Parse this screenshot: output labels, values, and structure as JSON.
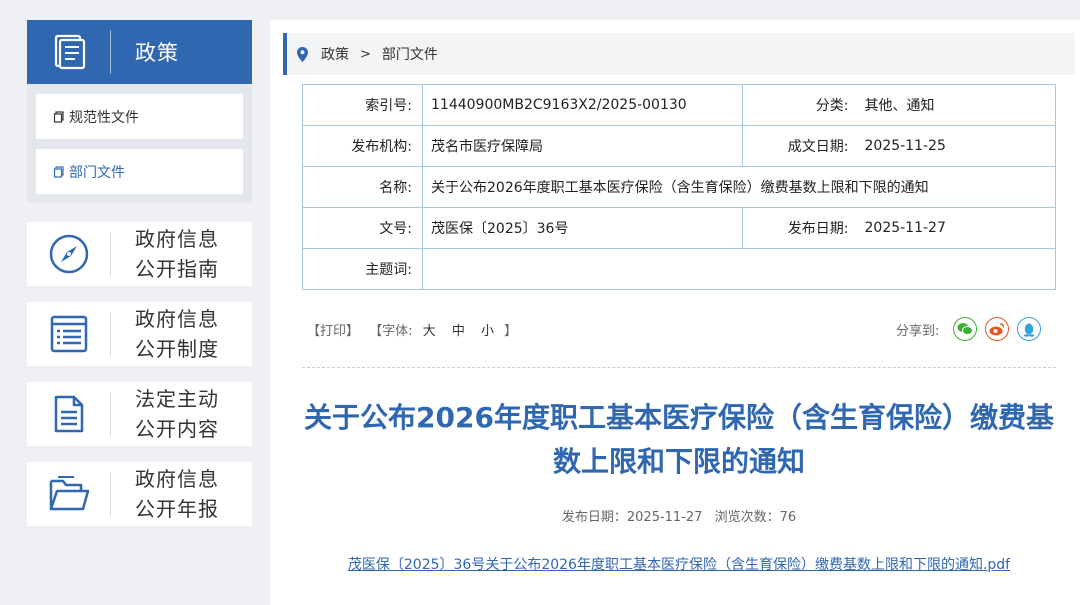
{
  "sidebar": {
    "header_title": "政策",
    "sub_items": [
      {
        "label": "规范性文件"
      },
      {
        "label": "部门文件"
      }
    ],
    "cards": [
      {
        "line1": "政府信息",
        "line2": "公开指南",
        "icon": "compass-icon"
      },
      {
        "line1": "政府信息",
        "line2": "公开制度",
        "icon": "list-document-icon"
      },
      {
        "line1": "法定主动",
        "line2": "公开内容",
        "icon": "document-icon"
      },
      {
        "line1": "政府信息",
        "line2": "公开年报",
        "icon": "folder-icon"
      }
    ]
  },
  "breadcrumb": {
    "items": [
      "政策",
      "部门文件"
    ],
    "separator": ">"
  },
  "meta": {
    "index_label": "索引号:",
    "index_value": "11440900MB2C9163X2/2025-00130",
    "category_label": "分类:",
    "category_value": "其他、通知",
    "org_label": "发布机构:",
    "org_value": "茂名市医疗保障局",
    "written_label": "成文日期:",
    "written_value": "2025-11-25",
    "name_label": "名称:",
    "name_value": "关于公布2026年度职工基本医疗保险（含生育保险）缴费基数上限和下限的通知",
    "docno_label": "文号:",
    "docno_value": "茂医保〔2025〕36号",
    "pubdate_label": "发布日期:",
    "pubdate_value": "2025-11-27",
    "subject_label": "主题词:",
    "subject_value": ""
  },
  "toolbar": {
    "print": "【打印】",
    "font_prefix": "【字体:",
    "font_large": "大",
    "font_medium": "中",
    "font_small": "小",
    "font_suffix": "】",
    "share_label": "分享到:"
  },
  "article": {
    "title": "关于公布2026年度职工基本医疗保险（含生育保险）缴费基数上限和下限的通知",
    "pub_date_text": "发布日期：2025-11-27",
    "views_text": "浏览次数：76",
    "attachment": "茂医保〔2025〕36号关于公布2026年度职工基本医疗保险（含生育保险）缴费基数上限和下限的通知.pdf"
  },
  "colors": {
    "brand": "#2f67b1",
    "wechat": "#3cb034",
    "weibo": "#e8541e",
    "qq": "#2fa3e0"
  }
}
